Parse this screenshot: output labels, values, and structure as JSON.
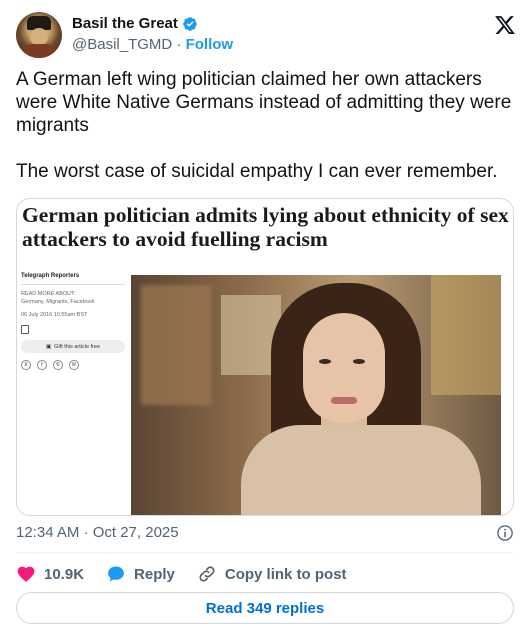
{
  "author": {
    "display_name": "Basil the Great",
    "handle": "@Basil_TGMD",
    "separator": "·",
    "follow_label": "Follow"
  },
  "tweet": {
    "text": "A German left wing politician claimed her own attackers were White Native Germans instead of admitting they were migrants\n\nThe worst case of suicidal empathy I can ever remember."
  },
  "media": {
    "headline": "German politician admits lying about ethnicity of sex attackers to avoid fuelling racism",
    "reporter": "Telegraph Reporters",
    "read_more_label": "READ MORE ABOUT:",
    "read_more_topics": "Germany, Migrants, Facebook",
    "date": "06 July 2016 10:55am BST",
    "gift_label": "Gift this article free",
    "share_icons": [
      "X",
      "f",
      "©",
      "✉"
    ]
  },
  "timestamp": "12:34 AM · Oct 27, 2025",
  "actions": {
    "likes": "10.9K",
    "reply_label": "Reply",
    "copy_link_label": "Copy link to post"
  },
  "replies_button": "Read 349 replies",
  "colors": {
    "accent": "#1d9bf0",
    "like": "#f91880",
    "muted": "#536471",
    "link": "#006fd6"
  }
}
